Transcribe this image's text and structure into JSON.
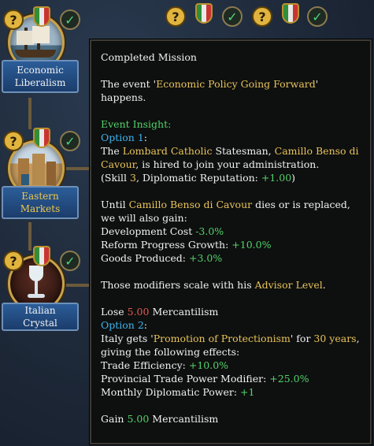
{
  "missions": [
    {
      "label": "Economic Liberalism"
    },
    {
      "label": "Eastern Markets"
    },
    {
      "label": "Italian Crystal"
    }
  ],
  "tooltip": {
    "title": "Completed Mission",
    "event_prefix": "The event '",
    "event_name": "Economic Policy Going Forward",
    "event_suffix": "' happens.",
    "event_insight": "Event Insight:",
    "option1_label": "Option 1",
    "option1_colon": ":",
    "o1_the": "The ",
    "o1_culture": "Lombard Catholic",
    "o1_statesman": " Statesman, ",
    "advisor_name": "Camillo Benso di Cavour",
    "o1_hired": ", is hired to join your administration.",
    "o1_skill_prefix": "(Skill ",
    "o1_skill": "3",
    "o1_rep_prefix": ", Diplomatic Reputation: ",
    "o1_rep": "+1.00",
    "o1_rep_suffix": ")",
    "until_prefix": "Until ",
    "until_name": "Camillo Benso di Cavour",
    "until_suffix": " dies or is replaced, we will also gain:",
    "mod1_label": "Development Cost ",
    "mod1_value": "-3.0%",
    "mod2_label": "Reform Progress Growth: ",
    "mod2_value": "+10.0%",
    "mod3_label": "Goods Produced: ",
    "mod3_value": "+3.0%",
    "scale_prefix": "Those modifiers scale with his ",
    "scale_highlight": "Advisor Level",
    "scale_suffix": ".",
    "lose_prefix": "Lose ",
    "lose_value": "5.00",
    "lose_suffix": " Mercantilism",
    "option2_label": "Option 2",
    "option2_colon": ":",
    "o2_prefix": "Italy gets '",
    "o2_modifier": "Promotion of Protectionism",
    "o2_for": "' for ",
    "o2_years": "30 years",
    "o2_suffix": ", giving the following effects:",
    "eff1_label": "Trade Efficiency: ",
    "eff1_value": "+10.0%",
    "eff2_label": "Provincial Trade Power Modifier: ",
    "eff2_value": "+25.0%",
    "eff3_label": "Monthly Diplomatic Power: ",
    "eff3_value": "+1",
    "gain_prefix": "Gain ",
    "gain_value": "5.00",
    "gain_suffix": " Mercantilism"
  }
}
